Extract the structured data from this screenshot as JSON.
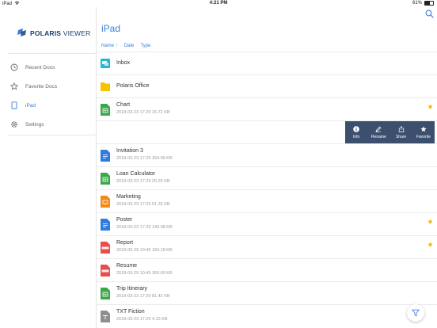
{
  "status": {
    "device": "iPad",
    "time": "4:21 PM",
    "battery": "61%",
    "battery_level": 0.61
  },
  "sidebar": {
    "logo": {
      "brand": "POLARIS",
      "product": "VIEWER"
    },
    "items": [
      {
        "label": "Recent Docs",
        "icon": "clock-icon"
      },
      {
        "label": "Favorite Docs",
        "icon": "star-outline-icon"
      },
      {
        "label": "iPad",
        "icon": "ipad-icon",
        "active": true
      },
      {
        "label": "Settings",
        "icon": "gear-icon"
      }
    ]
  },
  "main": {
    "title": "iPad",
    "sort": {
      "name": "Name",
      "date": "Date",
      "type": "Type",
      "arrow": "↑"
    },
    "files": [
      {
        "name": "Inbox",
        "meta": "",
        "kind": "inbox"
      },
      {
        "name": "Polaris Office",
        "meta": "",
        "kind": "folder"
      },
      {
        "name": "Chart",
        "meta": "2018-03-23 17:29  15.72 KB",
        "kind": "sheet",
        "favorite": true
      },
      {
        "name": "",
        "meta": "",
        "kind": "actions"
      },
      {
        "name": "Invitation 3",
        "meta": "2018-03-23 17:29  394.99 KB",
        "kind": "doc"
      },
      {
        "name": "Loan Calculator",
        "meta": "2018-03-23 17:29  20.25 KB",
        "kind": "sheet"
      },
      {
        "name": "Marketing",
        "meta": "2018-03-23 17:29  51.33 KB",
        "kind": "slide"
      },
      {
        "name": "Poster",
        "meta": "2018-03-23 17:29  149.98 KB",
        "kind": "doc",
        "favorite": true
      },
      {
        "name": "Report",
        "meta": "2018-03-29 10:46  184.18 KB",
        "kind": "pdf",
        "favorite": true
      },
      {
        "name": "Resume",
        "meta": "2018-03-29 10:45  360.69 KB",
        "kind": "pdf"
      },
      {
        "name": "Trip Itinerary",
        "meta": "2018-03-23 17:29  81.42 KB",
        "kind": "sheet"
      },
      {
        "name": "TXT Fiction",
        "meta": "2018-03-23 17:29  4.15 KB",
        "kind": "txt"
      }
    ],
    "actions": [
      {
        "label": "Info",
        "icon": "info-icon"
      },
      {
        "label": "Rename",
        "icon": "pencil-icon"
      },
      {
        "label": "Share",
        "icon": "share-icon"
      },
      {
        "label": "Favorite",
        "icon": "star-icon"
      }
    ]
  },
  "colors": {
    "accent": "#3b7dd8",
    "action_bar": "#3d4f6e",
    "star": "#f5b800",
    "folder": "#f8c300",
    "sheet": "#3aa84a",
    "doc": "#2f7be0",
    "slide": "#f08a1c",
    "pdf": "#e84e4e",
    "txt": "#8f8f8f",
    "inbox": "#27b5d8"
  }
}
